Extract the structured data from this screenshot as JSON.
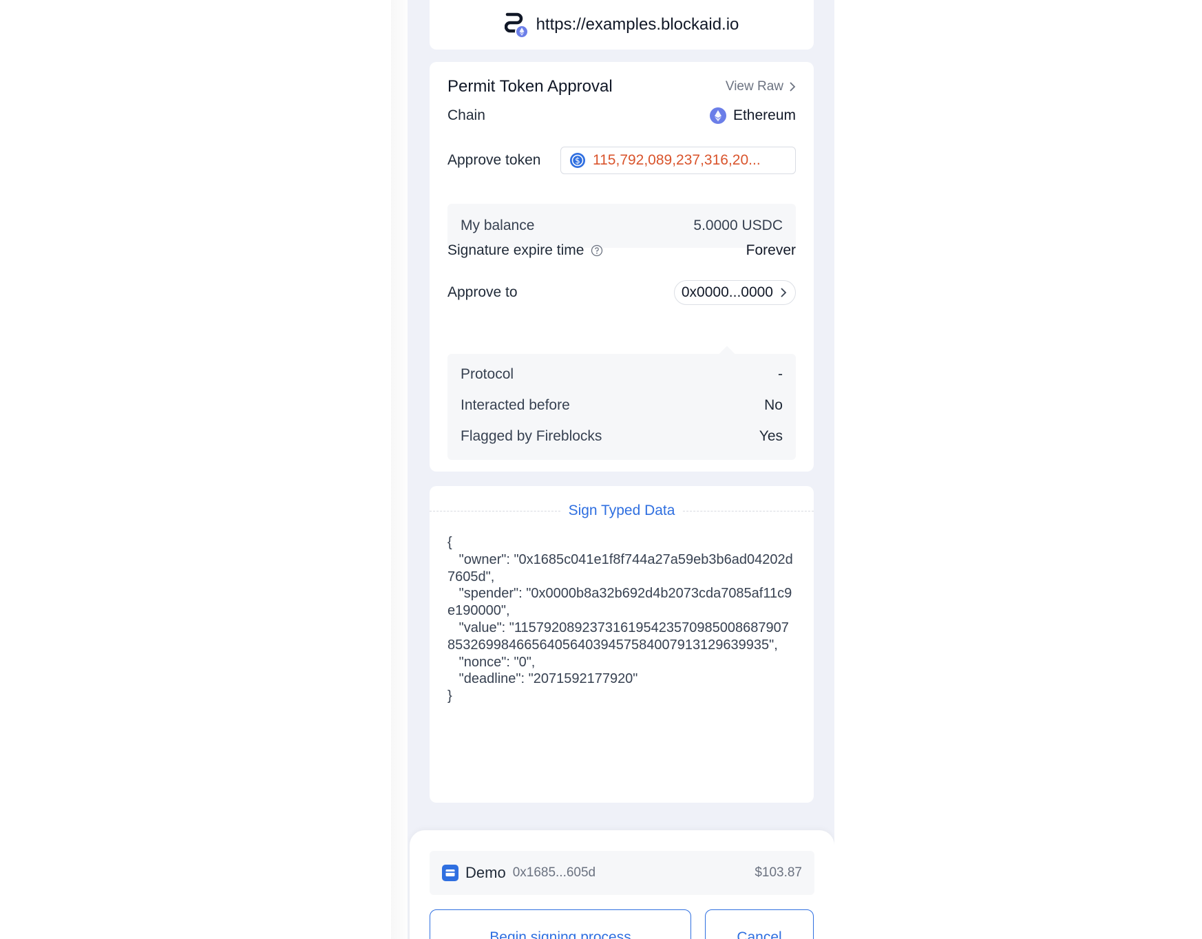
{
  "site": {
    "url": "https://examples.blockaid.io",
    "logo_icon": "blockaid-logo-icon"
  },
  "approval": {
    "title": "Permit Token Approval",
    "view_raw": "View Raw",
    "chain_label": "Chain",
    "chain_value": "Ethereum",
    "approve_token_label": "Approve token",
    "approve_token_amount": "115,792,089,237,316,20...",
    "balance_label": "My balance",
    "balance_value": "5.0000 USDC",
    "expire_label": "Signature expire time",
    "expire_value": "Forever",
    "approve_to_label": "Approve to",
    "approve_to_value": "0x0000...0000",
    "details": [
      {
        "label": "Protocol",
        "value": "-"
      },
      {
        "label": "Interacted before",
        "value": "No"
      },
      {
        "label": "Flagged by Fireblocks",
        "value": "Yes"
      }
    ]
  },
  "typed_data": {
    "header": "Sign Typed Data",
    "json": "{\n   \"owner\": \"0x1685c041e1f8f744a27a59eb3b6ad04202d7605d\",\n   \"spender\": \"0x0000b8a32b692d4b2073cda7085af11c9e190000\",\n   \"value\": \"115792089237316195423570985008687907853269984665640564039457584007913129639935\",\n   \"nonce\": \"0\",\n   \"deadline\": \"2071592177920\"\n}"
  },
  "account": {
    "name": "Demo",
    "address": "0x1685...605d",
    "balance": "$103.87"
  },
  "actions": {
    "begin": "Begin signing process",
    "cancel": "Cancel"
  },
  "colors": {
    "accent": "#2f6fe0",
    "warning": "#d9542c",
    "background": "#eff1f8",
    "eth": "#6b7ee8"
  }
}
